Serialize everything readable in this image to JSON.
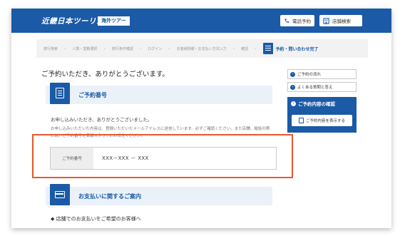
{
  "header": {
    "logo": "近畿日本ツーリスト",
    "badge": "海外ツアー",
    "tel_label": "電話予約",
    "store_label": "店舗検索"
  },
  "progress": {
    "steps": [
      "旅行検索",
      "人数・変動選択",
      "旅行条件確認",
      "ログイン",
      "お客様情報・お支払い方法入力",
      "確認"
    ],
    "active": "予約・問い合わせ完了"
  },
  "main": {
    "title": "ご予約いただき、ありがとうございます。",
    "section1_title": "ご予約番号",
    "thanks": "お申し込みいただき、ありがとうございました。",
    "notice": "お申し込みいただいた内容は、登録いただいたメールアドレスに送信しています。必ずご確認ください。また店舗、電話の際には、ご予約番号を店舗スタッフにお伝えください。",
    "reservation_label": "ご予約番号",
    "reservation_value": "XXX－XXX － XXX",
    "section2_title": "お支払いに関するご案内",
    "store_payment": "◆ 店舗でのお支払いをご希望のお客様へ"
  },
  "sidebar": {
    "link1": "ご予約の流れ",
    "link2": "よくある質問と答え",
    "confirm_title": "ご予約内容の確認",
    "confirm_button": "ご予約内容を表示する"
  },
  "colors": {
    "brand": "#1b5aa6",
    "highlight": "#e8572a"
  }
}
